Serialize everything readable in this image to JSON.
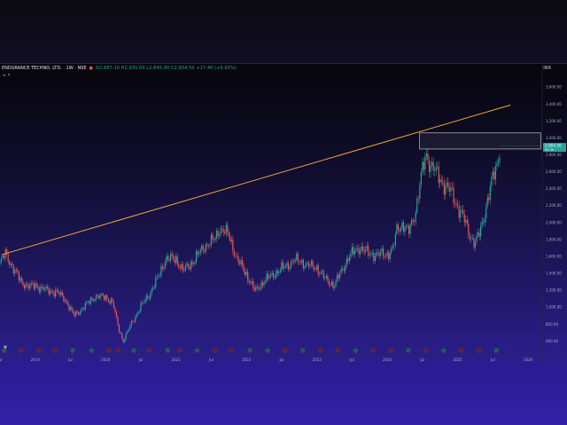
{
  "header": {
    "symbol": "ENDURANCE TECHNO. LTD. · 1W · NSE",
    "ohlc": "O2,887.10 H2,930.00 L2,845.00 C2,904.50 +17.40 (+0.60%)",
    "indicator_label": "≈ ↑",
    "currency": "INR"
  },
  "colors": {
    "up": "#26a69a",
    "down": "#ef5350",
    "trendline": "#f0a43a",
    "box": "#e0e0e0",
    "price_tag": "#26a69a"
  },
  "price_tag": {
    "price": "2,904.50",
    "countdown": "3d 2h"
  },
  "chart_data": {
    "type": "candlestick",
    "exchange": "NSE",
    "interval": "1W",
    "currency": "INR",
    "ylim": [
      500,
      3750
    ],
    "y_ticks": [
      {
        "value": 3600,
        "label": "3,600.00"
      },
      {
        "value": 3400,
        "label": "3,400.00"
      },
      {
        "value": 3200,
        "label": "3,200.00"
      },
      {
        "value": 3000,
        "label": "3,000.00"
      },
      {
        "value": 2800,
        "label": "2,800.00"
      },
      {
        "value": 2600,
        "label": "2,600.00"
      },
      {
        "value": 2400,
        "label": "2,400.00"
      },
      {
        "value": 2200,
        "label": "2,200.00"
      },
      {
        "value": 2000,
        "label": "2,000.00"
      },
      {
        "value": 1800,
        "label": "1,800.00"
      },
      {
        "value": 1600,
        "label": "1,600.00"
      },
      {
        "value": 1400,
        "label": "1,400.00"
      },
      {
        "value": 1200,
        "label": "1,200.00"
      },
      {
        "value": 1000,
        "label": "1,000.00"
      },
      {
        "value": 800,
        "label": "800.00"
      },
      {
        "value": 600,
        "label": "600.00"
      }
    ],
    "x_range": [
      2018.5,
      2026.2
    ],
    "x_ticks": [
      {
        "value": 2018.5,
        "label": "Jul"
      },
      {
        "value": 2019.0,
        "label": "2019"
      },
      {
        "value": 2019.5,
        "label": "Jul"
      },
      {
        "value": 2020.0,
        "label": "2020"
      },
      {
        "value": 2020.5,
        "label": "Jul"
      },
      {
        "value": 2021.0,
        "label": "2021"
      },
      {
        "value": 2021.5,
        "label": "Jul"
      },
      {
        "value": 2022.0,
        "label": "2022"
      },
      {
        "value": 2022.5,
        "label": "Jul"
      },
      {
        "value": 2023.0,
        "label": "2023"
      },
      {
        "value": 2023.5,
        "label": "Jul"
      },
      {
        "value": 2024.0,
        "label": "2024"
      },
      {
        "value": 2024.5,
        "label": "Jul"
      },
      {
        "value": 2025.0,
        "label": "2025"
      },
      {
        "value": 2025.5,
        "label": "Jul"
      },
      {
        "value": 2026.0,
        "label": "2026"
      }
    ],
    "price_path": [
      [
        2018.5,
        1520
      ],
      [
        2018.58,
        1640
      ],
      [
        2018.68,
        1470
      ],
      [
        2018.8,
        1300
      ],
      [
        2018.92,
        1240
      ],
      [
        2019.0,
        1260
      ],
      [
        2019.15,
        1200
      ],
      [
        2019.3,
        1180
      ],
      [
        2019.42,
        1100
      ],
      [
        2019.55,
        900
      ],
      [
        2019.7,
        1010
      ],
      [
        2019.85,
        1130
      ],
      [
        2020.0,
        1120
      ],
      [
        2020.1,
        1060
      ],
      [
        2020.18,
        760
      ],
      [
        2020.25,
        600
      ],
      [
        2020.35,
        780
      ],
      [
        2020.5,
        1010
      ],
      [
        2020.62,
        1150
      ],
      [
        2020.75,
        1360
      ],
      [
        2020.85,
        1570
      ],
      [
        2021.0,
        1570
      ],
      [
        2021.1,
        1430
      ],
      [
        2021.25,
        1550
      ],
      [
        2021.4,
        1720
      ],
      [
        2021.55,
        1800
      ],
      [
        2021.62,
        1940
      ],
      [
        2021.75,
        1850
      ],
      [
        2021.87,
        1560
      ],
      [
        2022.0,
        1390
      ],
      [
        2022.12,
        1190
      ],
      [
        2022.25,
        1310
      ],
      [
        2022.4,
        1400
      ],
      [
        2022.55,
        1480
      ],
      [
        2022.68,
        1560
      ],
      [
        2022.8,
        1530
      ],
      [
        2022.92,
        1480
      ],
      [
        2023.0,
        1470
      ],
      [
        2023.12,
        1330
      ],
      [
        2023.25,
        1260
      ],
      [
        2023.35,
        1430
      ],
      [
        2023.45,
        1590
      ],
      [
        2023.6,
        1710
      ],
      [
        2023.72,
        1640
      ],
      [
        2023.85,
        1620
      ],
      [
        2024.0,
        1630
      ],
      [
        2024.08,
        1680
      ],
      [
        2024.14,
        1940
      ],
      [
        2024.22,
        1980
      ],
      [
        2024.3,
        1880
      ],
      [
        2024.4,
        2130
      ],
      [
        2024.48,
        2530
      ],
      [
        2024.55,
        2810
      ],
      [
        2024.62,
        2680
      ],
      [
        2024.72,
        2550
      ],
      [
        2024.82,
        2440
      ],
      [
        2024.92,
        2340
      ],
      [
        2025.0,
        2190
      ],
      [
        2025.1,
        2020
      ],
      [
        2025.18,
        1840
      ],
      [
        2025.25,
        1750
      ],
      [
        2025.32,
        1900
      ],
      [
        2025.4,
        2180
      ],
      [
        2025.5,
        2530
      ],
      [
        2025.56,
        2700
      ],
      [
        2025.6,
        2905
      ]
    ],
    "last_price": 2904.5,
    "trendline": {
      "from": [
        2018.52,
        1620
      ],
      "to": [
        2025.75,
        3390
      ]
    },
    "resistance_box": {
      "x": [
        2024.46,
        2026.18
      ],
      "y": [
        2870,
        3060
      ]
    }
  },
  "events": [
    {
      "x": 2018.56,
      "kind": "D"
    },
    {
      "x": 2018.8,
      "kind": "E"
    },
    {
      "x": 2019.05,
      "kind": "E"
    },
    {
      "x": 2019.28,
      "kind": "E"
    },
    {
      "x": 2019.53,
      "kind": "D"
    },
    {
      "x": 2019.8,
      "kind": "D"
    },
    {
      "x": 2020.05,
      "kind": "E"
    },
    {
      "x": 2020.18,
      "kind": "E"
    },
    {
      "x": 2020.4,
      "kind": "D"
    },
    {
      "x": 2020.62,
      "kind": "E"
    },
    {
      "x": 2020.88,
      "kind": "D"
    },
    {
      "x": 2021.05,
      "kind": "E"
    },
    {
      "x": 2021.3,
      "kind": "D"
    },
    {
      "x": 2021.55,
      "kind": "E"
    },
    {
      "x": 2021.78,
      "kind": "E"
    },
    {
      "x": 2022.05,
      "kind": "D"
    },
    {
      "x": 2022.3,
      "kind": "D"
    },
    {
      "x": 2022.55,
      "kind": "E"
    },
    {
      "x": 2022.8,
      "kind": "D"
    },
    {
      "x": 2023.05,
      "kind": "E"
    },
    {
      "x": 2023.3,
      "kind": "E"
    },
    {
      "x": 2023.55,
      "kind": "D"
    },
    {
      "x": 2023.8,
      "kind": "E"
    },
    {
      "x": 2024.05,
      "kind": "E"
    },
    {
      "x": 2024.3,
      "kind": "D"
    },
    {
      "x": 2024.55,
      "kind": "E"
    },
    {
      "x": 2024.8,
      "kind": "D"
    },
    {
      "x": 2025.05,
      "kind": "E"
    },
    {
      "x": 2025.3,
      "kind": "E"
    },
    {
      "x": 2025.55,
      "kind": "D"
    }
  ]
}
